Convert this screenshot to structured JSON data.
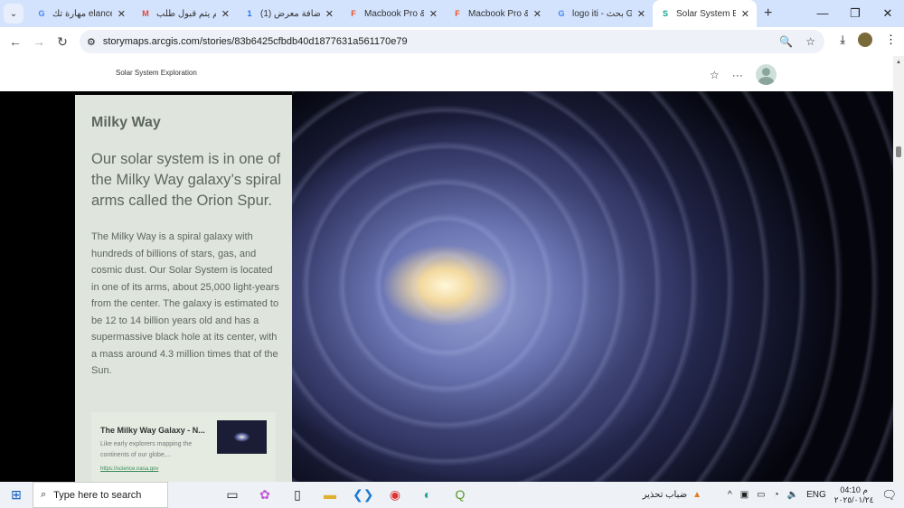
{
  "browser": {
    "tabs": [
      {
        "label": "مهارة تك elancer",
        "icon": "G"
      },
      {
        "label": "لم يتم قبول طلب",
        "icon": "M"
      },
      {
        "label": "(1) إضافة معرض",
        "icon": "1"
      },
      {
        "label": "Macbook Pro &",
        "icon": "F"
      },
      {
        "label": "Macbook Pro &",
        "icon": "F"
      },
      {
        "label": "logo iti - بحث G",
        "icon": "G"
      },
      {
        "label": "Solar System Exp",
        "icon": "S",
        "active": true
      }
    ],
    "url": "storymaps.arcgis.com/stories/83b6425cfbdb40d1877631a561170e79"
  },
  "story": {
    "header_title": "Solar System Exploration",
    "section_title": "Milky Way",
    "lead": "Our solar system is in one of the Milky Way galaxy’s spiral arms called the Orion Spur.",
    "body": "The Milky Way is a spiral galaxy with hundreds of billions of stars, gas, and cosmic dust. Our Solar System is located in one of its arms, about 25,000 light-years from the center. The galaxy is estimated to be 12 to 14 billion years old and has a supermassive black hole at its center, with a mass around 4.3 million times that of the Sun.",
    "card": {
      "title": "The Milky Way Galaxy - N...",
      "description": "Like early explorers mapping the continents of our globe,...",
      "url": "https://science.nasa.gov"
    }
  },
  "taskbar": {
    "search_placeholder": "Type here to search",
    "weather": "ضباب تحذير",
    "language": "ENG",
    "time": "04:10 م",
    "date": "٢٠٢٥/٠١/٢٤"
  }
}
